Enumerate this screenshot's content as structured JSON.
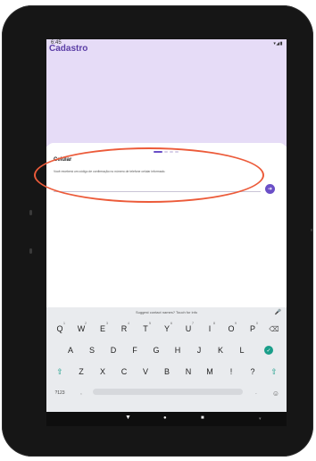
{
  "app": {
    "title": "Cadastro"
  },
  "status_bar": {
    "time": "6:45",
    "system_icons": "▾◢▮"
  },
  "step_card": {
    "title": "Celular",
    "message": "Você receberá um código de confirmação no número de telefone celular informado.",
    "input_value": "",
    "next_icon": "arrow-right-icon"
  },
  "keyboard": {
    "suggestion_text": "Suggest contact names? Touch for info",
    "row1": [
      {
        "label": "Q",
        "hint": "1"
      },
      {
        "label": "W",
        "hint": "2"
      },
      {
        "label": "E",
        "hint": "3"
      },
      {
        "label": "R",
        "hint": "4"
      },
      {
        "label": "T",
        "hint": "5"
      },
      {
        "label": "Y",
        "hint": "6"
      },
      {
        "label": "U",
        "hint": "7"
      },
      {
        "label": "I",
        "hint": "8"
      },
      {
        "label": "O",
        "hint": "9"
      },
      {
        "label": "P",
        "hint": "0"
      }
    ],
    "row2": [
      "A",
      "S",
      "D",
      "F",
      "G",
      "H",
      "J",
      "K",
      "L"
    ],
    "row3": [
      "Z",
      "X",
      "C",
      "V",
      "B",
      "N",
      "M",
      "!",
      "?"
    ],
    "symbols_label": "?123",
    "comma_label": ",",
    "period_label": ".",
    "backspace_icon": "⌫",
    "shift_icon": "⇧",
    "enter_icon": "✓",
    "emoji_icon": "☺"
  },
  "colors": {
    "accent": "#6a4fc7",
    "header_bg": "#e6dcf7",
    "highlight": "#ec5b3a",
    "teal": "#1a9e8a"
  }
}
